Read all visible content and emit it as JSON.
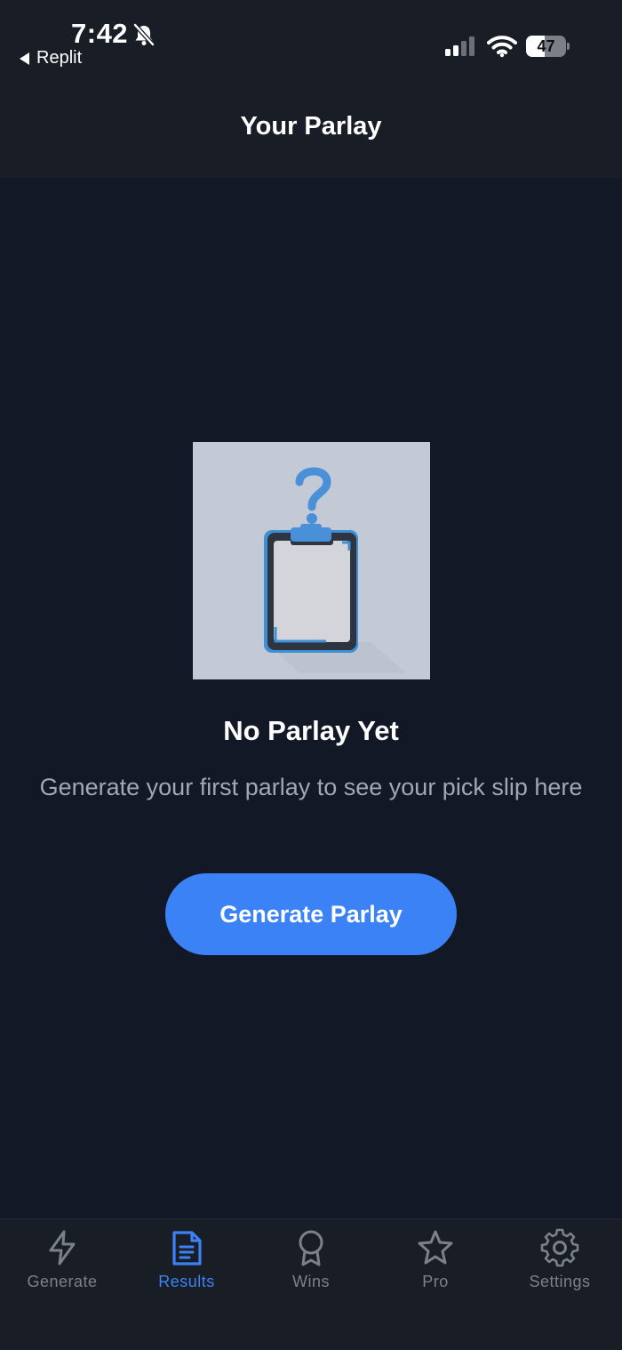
{
  "status_bar": {
    "time": "7:42",
    "back_app": "Replit",
    "battery": "47",
    "battery_level": 0.47
  },
  "header": {
    "title": "Your Parlay"
  },
  "empty_state": {
    "title": "No Parlay Yet",
    "subtitle": "Generate your first parlay to see your pick slip here",
    "cta_label": "Generate Parlay",
    "illustration": "clipboard-question-illustration"
  },
  "tabs": [
    {
      "label": "Generate",
      "icon": "lightning-icon",
      "active": false
    },
    {
      "label": "Results",
      "icon": "document-icon",
      "active": true
    },
    {
      "label": "Wins",
      "icon": "award-ribbon-icon",
      "active": false
    },
    {
      "label": "Pro",
      "icon": "star-icon",
      "active": false
    },
    {
      "label": "Settings",
      "icon": "gear-icon",
      "active": false
    }
  ],
  "colors": {
    "background": "#121826",
    "bar": "#191d25",
    "accent": "#3b82f6",
    "inactive": "#7b818c",
    "muted_text": "#a1a8b3"
  }
}
